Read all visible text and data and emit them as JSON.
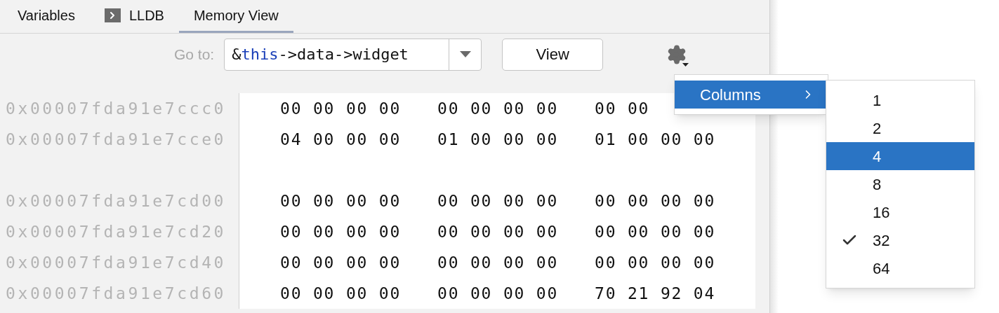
{
  "tabs": [
    {
      "label": "Variables",
      "kind": "plain",
      "selected": false
    },
    {
      "label": "LLDB",
      "kind": "console",
      "selected": false
    },
    {
      "label": "Memory View",
      "kind": "plain",
      "selected": true
    }
  ],
  "toolbar": {
    "goto_label": "Go to:",
    "goto_value": [
      {
        "text": "&",
        "keyword": false
      },
      {
        "text": "this",
        "keyword": true
      },
      {
        "text": "->data->widget",
        "keyword": false
      }
    ],
    "view_button": "View"
  },
  "rows": [
    {
      "kind": "data",
      "address": "0x00007fda91e7ccc0",
      "groups": [
        "00 00 00 00",
        "00 00 00 00",
        "00 00"
      ]
    },
    {
      "kind": "data",
      "address": "0x00007fda91e7cce0",
      "groups": [
        "04 00 00 00",
        "01 00 00 00",
        "01 00 00 00"
      ]
    },
    {
      "kind": "gap"
    },
    {
      "kind": "data",
      "address": "0x00007fda91e7cd00",
      "groups": [
        "00 00 00 00",
        "00 00 00 00",
        "00 00 00 00"
      ]
    },
    {
      "kind": "data",
      "address": "0x00007fda91e7cd20",
      "groups": [
        "00 00 00 00",
        "00 00 00 00",
        "00 00 00 00"
      ]
    },
    {
      "kind": "data",
      "address": "0x00007fda91e7cd40",
      "groups": [
        "00 00 00 00",
        "00 00 00 00",
        "00 00 00 00"
      ]
    },
    {
      "kind": "data",
      "address": "0x00007fda91e7cd60",
      "groups": [
        "00 00 00 00",
        "00 00 00 00",
        "70 21 92 04"
      ]
    }
  ],
  "menu": {
    "items": [
      {
        "label": "Columns",
        "selected": true
      }
    ]
  },
  "submenu": {
    "items": [
      {
        "label": "1",
        "selected": false,
        "checked": false
      },
      {
        "label": "2",
        "selected": false,
        "checked": false
      },
      {
        "label": "4",
        "selected": true,
        "checked": false
      },
      {
        "label": "8",
        "selected": false,
        "checked": false
      },
      {
        "label": "16",
        "selected": false,
        "checked": false
      },
      {
        "label": "32",
        "selected": false,
        "checked": true
      },
      {
        "label": "64",
        "selected": false,
        "checked": false
      }
    ]
  }
}
